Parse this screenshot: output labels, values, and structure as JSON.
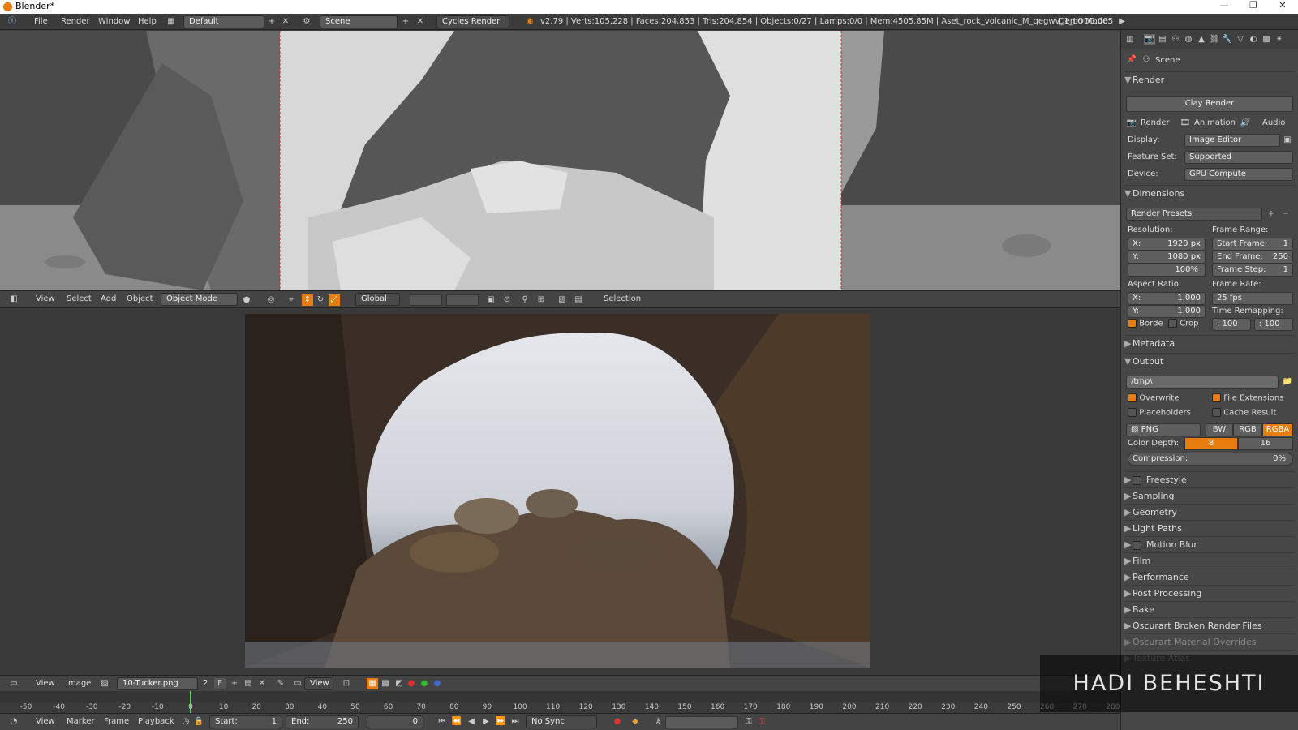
{
  "window": {
    "title": "Blender*",
    "minimize": "—",
    "maximize": "❐",
    "close": "✕"
  },
  "info": {
    "menus": [
      "File",
      "Render",
      "Window",
      "Help"
    ],
    "layout": "Default",
    "scene": "Scene",
    "engine": "Cycles Render",
    "stats": "v2.79 | Verts:105,228 | Faces:204,853 | Tris:204,854 | Objects:0/27 | Lamps:0/0 | Mem:4505.85M | Aset_rock_volcanic_M_qegwv_1_LOD0.005",
    "demo": "Demo Mode:"
  },
  "header3d": {
    "menus": [
      "View",
      "Select",
      "Add",
      "Object"
    ],
    "mode": "Object Mode",
    "orientation": "Global",
    "selection": "Selection"
  },
  "headerimg": {
    "menus": [
      "View",
      "Image"
    ],
    "image": "10-Tucker.png",
    "users": "2",
    "fake": "F",
    "view": "View"
  },
  "timeline": {
    "ticks": [
      "-50",
      "-40",
      "-30",
      "-20",
      "-10",
      "0",
      "10",
      "20",
      "30",
      "40",
      "50",
      "60",
      "70",
      "80",
      "90",
      "100",
      "110",
      "120",
      "130",
      "140",
      "150",
      "160",
      "170",
      "180",
      "190",
      "200",
      "210",
      "220",
      "230",
      "240",
      "250",
      "260",
      "270",
      "280"
    ],
    "current_frame": 0
  },
  "headertl": {
    "menus": [
      "View",
      "Marker",
      "Frame",
      "Playback"
    ],
    "start_label": "Start:",
    "start": "1",
    "end_label": "End:",
    "end": "250",
    "frame": "0",
    "sync": "No Sync"
  },
  "props": {
    "scene": "Scene",
    "render": {
      "title": "Render",
      "clay": "Clay Render",
      "tabs": [
        "Render",
        "Animation",
        "Audio"
      ],
      "display_label": "Display:",
      "display": "Image Editor",
      "feature_label": "Feature Set:",
      "feature": "Supported",
      "device_label": "Device:",
      "device": "GPU Compute"
    },
    "dimensions": {
      "title": "Dimensions",
      "presets": "Render Presets",
      "resolution": "Resolution:",
      "res_x": "1920 px",
      "res_y": "1080 px",
      "res_pct": "100%",
      "x_label": "X:",
      "y_label": "Y:",
      "frame_range": "Frame Range:",
      "start": "Start Frame:",
      "start_val": "1",
      "end": "End Frame:",
      "end_val": "250",
      "step": "Frame Step:",
      "step_val": "1",
      "aspect": "Aspect Ratio:",
      "asp_x": "1.000",
      "asp_y": "1.000",
      "frame_rate": "Frame Rate:",
      "fps": "25 fps",
      "remap": "Time Remapping:",
      "remap_old": ": 100",
      "remap_new": ": 100",
      "border": "Borde",
      "crop": "Crop"
    },
    "metadata": "Metadata",
    "output": {
      "title": "Output",
      "path": "/tmp\\",
      "overwrite": "Overwrite",
      "file_ext": "File Extensions",
      "placeholders": "Placeholders",
      "cache": "Cache Result",
      "format": "PNG",
      "bw": "BW",
      "rgb": "RGB",
      "rgba": "RGBA",
      "depth_label": "Color Depth:",
      "depth8": "8",
      "depth16": "16",
      "compression": "Compression:",
      "comp_val": "0%"
    },
    "collapsed": [
      "Freestyle",
      "Sampling",
      "Geometry",
      "Light Paths",
      "Motion Blur",
      "Film",
      "Performance",
      "Post Processing",
      "Bake",
      "Oscurart Broken Render Files",
      "Oscurart Material Overrides",
      "Texture Atlas"
    ]
  },
  "watermark": "HADI BEHESHTI",
  "colors": {
    "accent": "#e87d0d",
    "panel": "#474747",
    "header": "#444444"
  }
}
